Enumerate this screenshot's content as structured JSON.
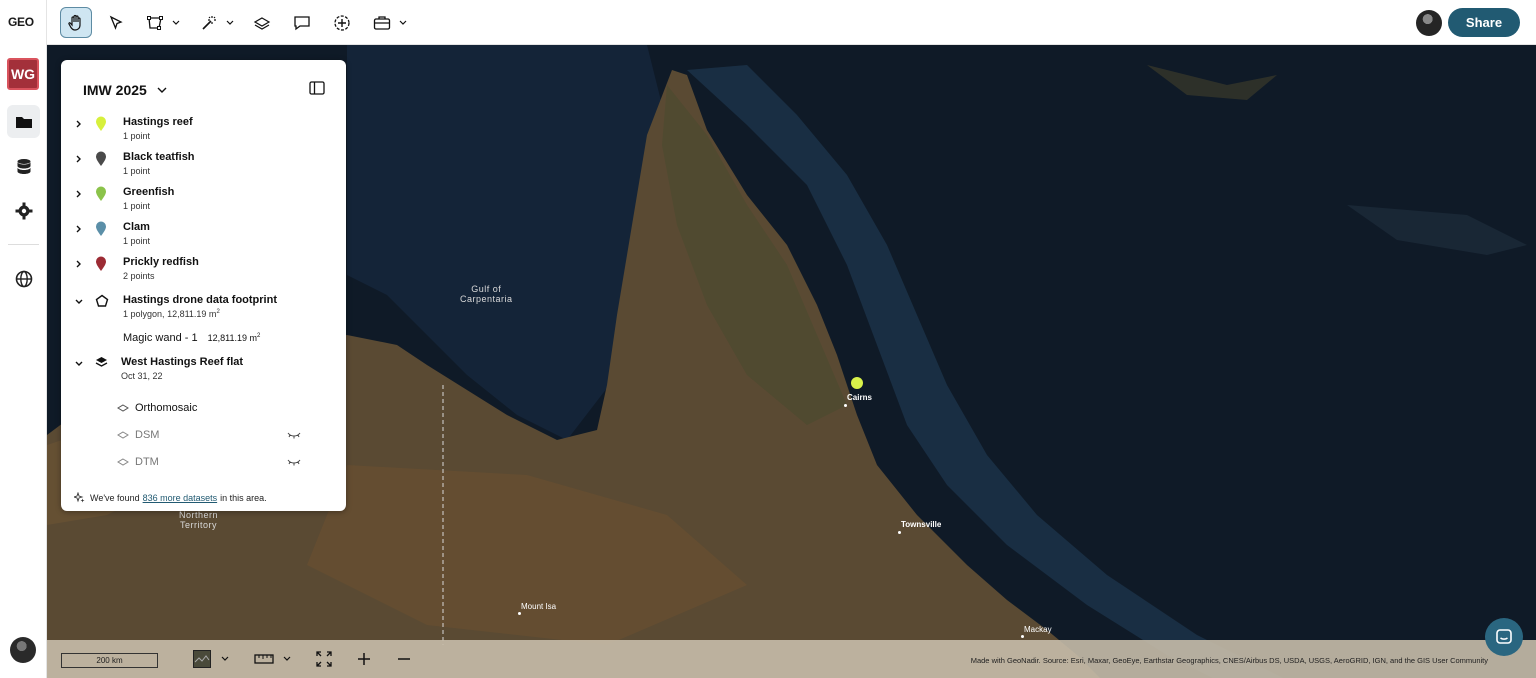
{
  "app": {
    "logo": "GEO",
    "workspace_badge": "WG"
  },
  "toolbar": {
    "tools": [
      "pan",
      "select",
      "polygon",
      "magic-wand",
      "layers-add",
      "comment",
      "add-point",
      "toolkit"
    ],
    "share_label": "Share"
  },
  "panel": {
    "title": "IMW 2025",
    "layers": [
      {
        "name": "Hastings reef",
        "subtitle": "1 point",
        "color": "#d7f03c"
      },
      {
        "name": "Black teatfish",
        "subtitle": "1 point",
        "color": "#4a4a4a"
      },
      {
        "name": "Greenfish",
        "subtitle": "1 point",
        "color": "#8bc34a"
      },
      {
        "name": "Clam",
        "subtitle": "1 point",
        "color": "#5b8fa8"
      },
      {
        "name": "Prickly redfish",
        "subtitle": "2 points",
        "color": "#9c2b34"
      }
    ],
    "footprint": {
      "name": "Hastings drone data footprint",
      "subtitle_prefix": "1 polygon,",
      "area": "12,811.19 m",
      "area_sup": "2",
      "child_name": "Magic wand - 1",
      "child_area": "12,811.19 m",
      "child_area_sup": "2"
    },
    "dataset": {
      "name": "West Hastings Reef flat",
      "date": "Oct 31, 22",
      "products": [
        "Orthomosaic",
        "DSM",
        "DTM"
      ]
    },
    "found": {
      "prefix": "We've found",
      "link": "836 more datasets",
      "suffix": "in this area."
    }
  },
  "map": {
    "labels": {
      "gulf_1": "Gulf of",
      "gulf_2": "Carpentaria",
      "nt_1": "Northern",
      "nt_2": "Territory"
    },
    "cities": {
      "cairns": "Cairns",
      "townsville": "Townsville",
      "mount_isa": "Mount Isa",
      "mackay": "Mackay"
    },
    "marker_color": "#d9f24a"
  },
  "bottom": {
    "scale": "200 km",
    "attribution": "Made with GeoNadir. Source: Esri, Maxar, GeoEye, Earthstar Geographics, CNES/Airbus DS, USDA, USGS, AeroGRID, IGN, and the GIS User Community"
  }
}
